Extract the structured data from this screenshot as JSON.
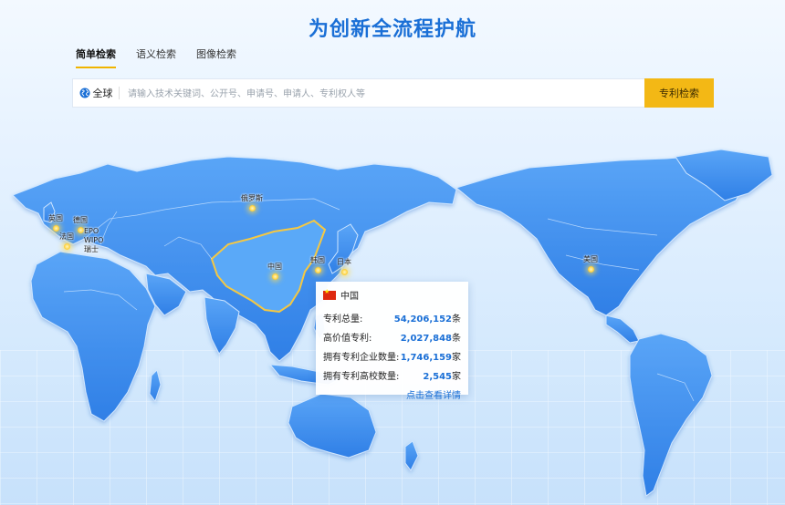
{
  "title": "为创新全流程护航",
  "tabs": [
    {
      "label": "简单检索",
      "active": true
    },
    {
      "label": "语义检索",
      "active": false
    },
    {
      "label": "图像检索",
      "active": false
    }
  ],
  "search": {
    "scope_label": "全球",
    "placeholder": "请输入技术关键词、公开号、申请号、申请人、专利权人等",
    "button_label": "专利检索"
  },
  "markers": {
    "uk": "英国",
    "germany": "德国",
    "france": "法国",
    "epo": "EPO",
    "wipo": "WIPO",
    "switzerland": "瑞士",
    "russia": "俄罗斯",
    "china": "中国",
    "korea": "韩国",
    "japan": "日本",
    "usa": "美国"
  },
  "tooltip": {
    "country": "中国",
    "rows": [
      {
        "label": "专利总量:",
        "value": "54,206,152",
        "unit": "条"
      },
      {
        "label": "高价值专利:",
        "value": "2,027,848",
        "unit": "条"
      },
      {
        "label": "拥有专利企业数量:",
        "value": "1,746,159",
        "unit": "家"
      },
      {
        "label": "拥有专利高校数量:",
        "value": "2,545",
        "unit": "家"
      }
    ],
    "link": "点击查看详情"
  },
  "colors": {
    "accent": "#1a6fd6",
    "button": "#f3b815",
    "land": "#3c8ef0",
    "highlight_border": "#f5c842"
  }
}
